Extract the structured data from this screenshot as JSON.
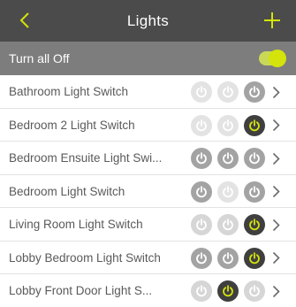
{
  "header": {
    "title": "Lights",
    "back_icon": "chevron-left-icon",
    "add_icon": "plus-icon",
    "accent": "#d3e30b",
    "background": "#4b4b4b"
  },
  "all_off": {
    "label": "Turn all Off",
    "toggle_on": true,
    "background": "#7d7d7d"
  },
  "power_icon": "power-icon",
  "state_colors": {
    "on": "#3f3f3f",
    "mid": "#a3a3a3",
    "dim": "#d6d6d6",
    "faint": "#e3e3e3",
    "active_glyph": "#d3e30b"
  },
  "switches": [
    {
      "name": "Bathroom Light Switch",
      "buttons": [
        "faint",
        "faint",
        "mid"
      ]
    },
    {
      "name": "Bedroom 2 Light Switch",
      "buttons": [
        "faint",
        "faint",
        "on"
      ]
    },
    {
      "name": "Bedroom Ensuite Light Swi...",
      "buttons": [
        "mid",
        "mid",
        "mid"
      ]
    },
    {
      "name": "Bedroom Light Switch",
      "buttons": [
        "mid",
        "faint",
        "mid"
      ]
    },
    {
      "name": "Living Room Light Switch",
      "buttons": [
        "dim",
        "dim",
        "on"
      ]
    },
    {
      "name": "Lobby Bedroom Light Switch",
      "buttons": [
        "mid",
        "mid",
        "on"
      ]
    },
    {
      "name": "Lobby Front Door Light S...",
      "buttons": [
        "dim",
        "on",
        "dim"
      ]
    }
  ]
}
